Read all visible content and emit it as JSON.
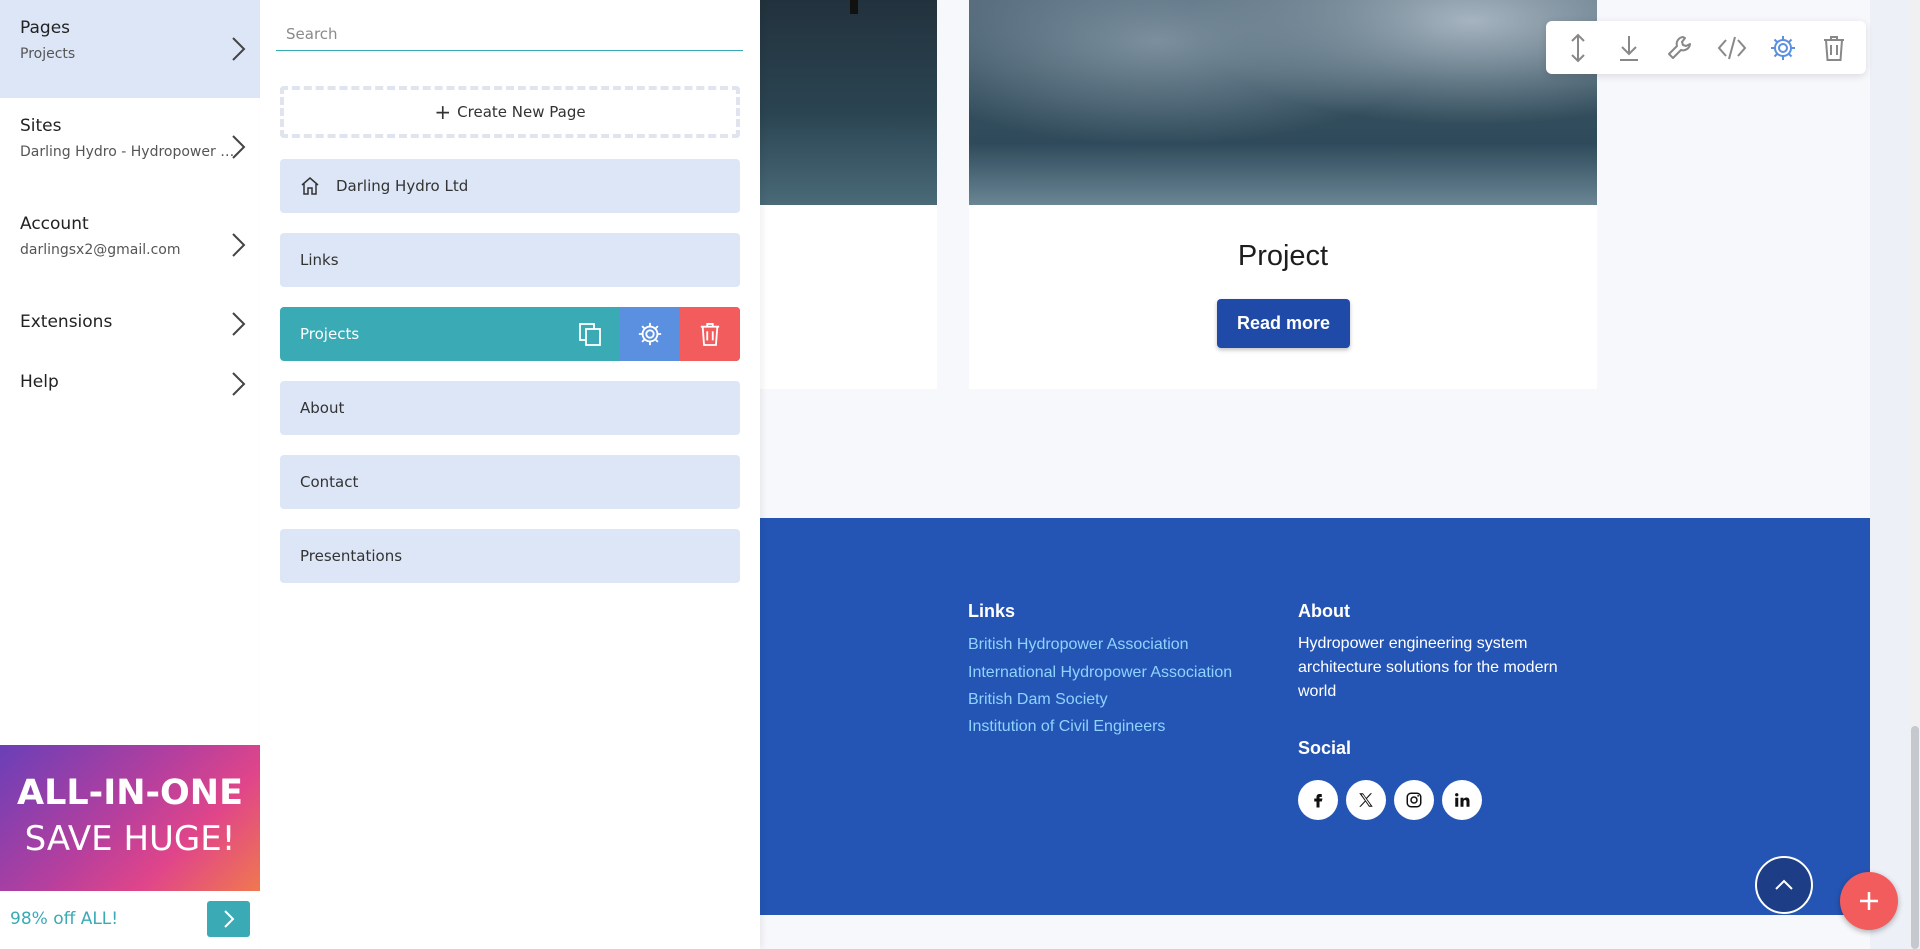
{
  "nav": {
    "items": [
      {
        "title": "Pages",
        "sub": "Projects"
      },
      {
        "title": "Sites",
        "sub": "Darling Hydro - Hydropower engineering"
      },
      {
        "title": "Account",
        "sub": "darlingsx2@gmail.com"
      },
      {
        "title": "Extensions",
        "sub": ""
      },
      {
        "title": "Help",
        "sub": ""
      }
    ]
  },
  "promo": {
    "line1": "ALL-IN-ONE",
    "line2": "SAVE HUGE!",
    "text": "98% off ALL!"
  },
  "panel": {
    "search_placeholder": "Search",
    "create_label": "Create New Page",
    "pages": [
      "Darling Hydro Ltd",
      "Links",
      "Projects",
      "About",
      "Contact",
      "Presentations"
    ]
  },
  "preview": {
    "card_title": "Project",
    "read_more": "Read more",
    "footer": {
      "links_heading": "Links",
      "links": [
        "British Hydropower Association",
        "International Hydropower Association",
        "British Dam Society",
        "Institution of Civil Engineers"
      ],
      "about_heading": "About",
      "about_text": "Hydropower engineering system architecture solutions for the modern world",
      "social_heading": "Social",
      "social": [
        "f",
        "X",
        "instagram",
        "in"
      ]
    }
  },
  "colors": {
    "accent": "#3aaab5",
    "footer_bg": "#2455b4",
    "button_blue": "#1f4aa8",
    "delete_red": "#f25c5c",
    "settings_blue": "#5b8fe0",
    "nav_active": "#dde6f7"
  },
  "icons": {
    "toolbar": [
      "move-vertical-icon",
      "download-icon",
      "wrench-icon",
      "code-icon",
      "gear-icon",
      "trash-icon"
    ]
  }
}
